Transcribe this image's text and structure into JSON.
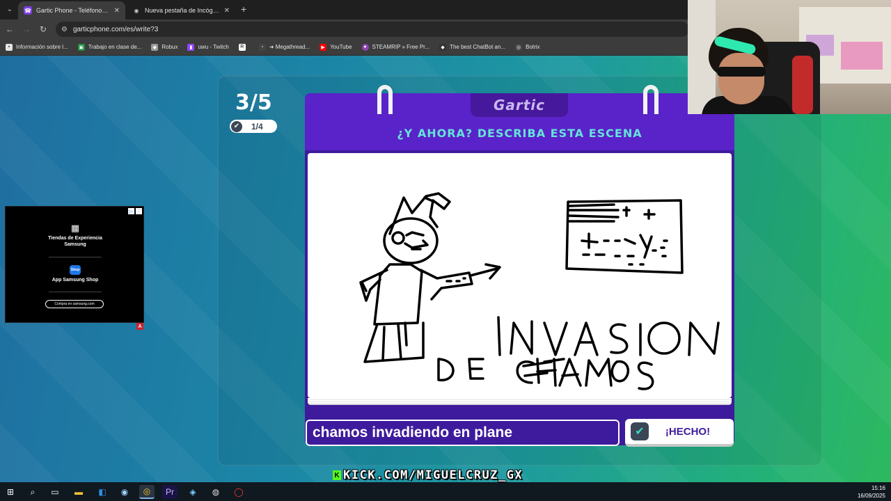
{
  "browser": {
    "tabs": [
      {
        "title": "Gartic Phone - Teléfono Descon",
        "active": true,
        "favicon": "gartic-phone-icon"
      },
      {
        "title": "Nueva pestaña de Incógnito",
        "active": false,
        "favicon": "incognito-icon"
      }
    ],
    "url": "garticphone.com/es/write?3",
    "bookmarks": [
      {
        "label": "Información sobre l...",
        "icon": "roblox-icon",
        "color": "#e5e5e5"
      },
      {
        "label": "Trabajo en clase de...",
        "icon": "classroom-icon",
        "color": "#1e8e3e"
      },
      {
        "label": "Robux",
        "icon": "roblox-icon",
        "color": "#9b9b9b"
      },
      {
        "label": "uwu - Twitch",
        "icon": "twitch-icon",
        "color": "#9146ff"
      },
      {
        "label": "",
        "icon": "r-icon",
        "color": "#ffffff"
      },
      {
        "label": "➜ Megathread...",
        "icon": "link-icon",
        "color": "#444444"
      },
      {
        "label": "YouTube",
        "icon": "youtube-icon",
        "color": "#ff0000"
      },
      {
        "label": "STEAMRIP » Free Pr...",
        "icon": "steamrip-icon",
        "color": "#8e44ad"
      },
      {
        "label": "The best ChatBot an...",
        "icon": "chatbot-icon",
        "color": "#333333"
      },
      {
        "label": "Botrix",
        "icon": "botrix-icon",
        "color": "#444444"
      }
    ]
  },
  "game": {
    "round": "3/5",
    "progress": "1/4",
    "logo": "Gartic",
    "instruction": "¿Y AHORA? DESCRIBA ESTA ESCENA",
    "drawing_text": [
      "INVASION",
      "DE",
      "CHAMOS"
    ],
    "answer_value": "chamos invadiendo en plane",
    "done_label": "¡HECHO!",
    "accent_color": "#5a22c9",
    "highlight_color": "#65e3d9"
  },
  "ad": {
    "line1": "Tiendas de Experiencia",
    "line2": "Samsung",
    "shop_icon_text": "Shop",
    "line3": "App Samsung Shop",
    "cta": "Compra en samsung.com",
    "badge": "A"
  },
  "stream": {
    "banner": "KICK.COM/MIGUELCRUZ_GX",
    "logo": "K"
  },
  "taskbar": {
    "time": "15:16",
    "date": "16/09/2025"
  }
}
